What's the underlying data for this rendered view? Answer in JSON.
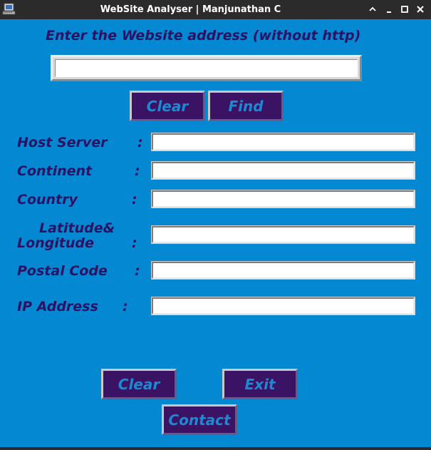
{
  "window": {
    "title": "WebSite Analyser | Manjunathan C",
    "controls": [
      "chevron-up-icon",
      "minimize-icon",
      "maximize-icon",
      "close-icon"
    ]
  },
  "form": {
    "heading": "Enter the Website address (without http)",
    "url_input": {
      "value": "",
      "placeholder": ""
    },
    "clear_label": "Clear",
    "find_label": "Find"
  },
  "fields": {
    "host_server": {
      "label": "Host Server",
      "colon": ":",
      "value": ""
    },
    "continent": {
      "label": "Continent",
      "colon": ":",
      "value": ""
    },
    "country": {
      "label": "Country",
      "colon": ":",
      "value": ""
    },
    "latlong": {
      "label_line1": "Latitude&",
      "label_line2": "Longitude",
      "colon": ":",
      "value": ""
    },
    "postal_code": {
      "label": "Postal Code",
      "colon": ":",
      "value": ""
    },
    "ip_address": {
      "label": "IP Address",
      "colon": ":",
      "value": ""
    }
  },
  "actions": {
    "clear_label": "Clear",
    "exit_label": "Exit",
    "contact_label": "Contact"
  },
  "colors": {
    "background": "#0388d1",
    "label_text": "#2d1263",
    "button_bg": "#3a1365",
    "button_text": "#1a8ad2",
    "titlebar": "#2b2b2b"
  }
}
